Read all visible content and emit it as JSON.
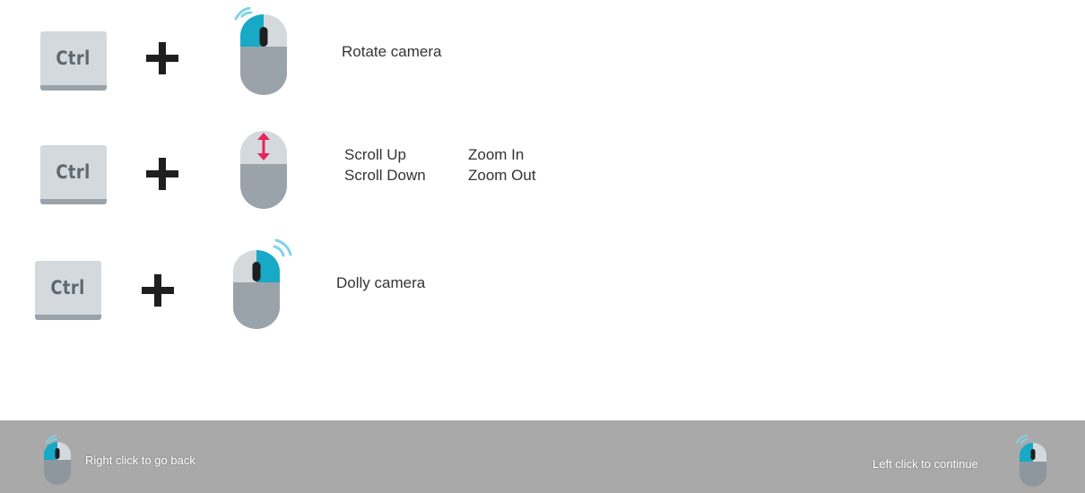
{
  "rows": [
    {
      "key_label": "Ctrl",
      "plus": "+",
      "mouse_icon": "mouse-right-click-icon",
      "action": "Rotate camera"
    },
    {
      "key_label": "Ctrl",
      "plus": "+",
      "mouse_icon": "mouse-scroll-icon",
      "scroll_up": "Scroll Up",
      "scroll_down": "Scroll Down",
      "zoom_in": "Zoom In",
      "zoom_out": "Zoom Out"
    },
    {
      "key_label": "Ctrl",
      "plus": "+",
      "mouse_icon": "mouse-left-click-icon",
      "action": "Dolly camera"
    }
  ],
  "footer": {
    "back_label": "Right click to go back",
    "continue_label": "Left click to continue"
  },
  "colors": {
    "key_face": "#d4d9dd",
    "key_edge": "#9aa3a9",
    "mouse_body": "#d4d9dd",
    "mouse_lower": "#9aa3a9",
    "accent_cyan": "#17a9c6",
    "accent_pink": "#e8245c",
    "footer_bg": "#a9a9a9"
  }
}
